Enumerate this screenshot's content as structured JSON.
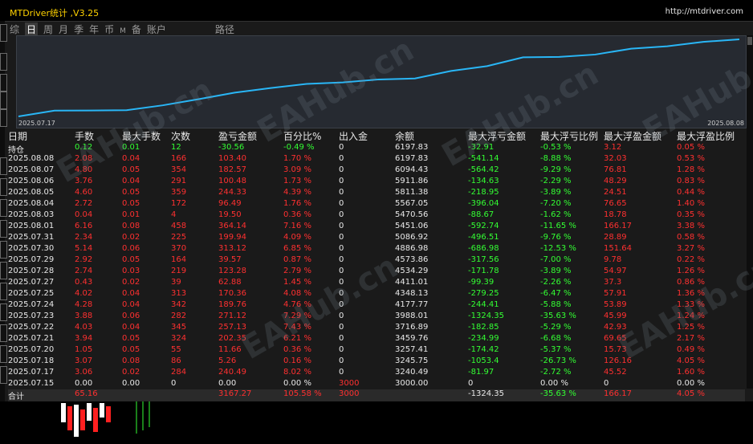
{
  "window": {
    "title": "MTDriver统计 ,V3.25",
    "url": "http://mtdriver.com"
  },
  "tabs": [
    {
      "label": "综",
      "active": false,
      "small": false
    },
    {
      "label": "日",
      "active": true,
      "small": false
    },
    {
      "label": "周",
      "active": false,
      "small": false
    },
    {
      "label": "月",
      "active": false,
      "small": false
    },
    {
      "label": "季",
      "active": false,
      "small": false
    },
    {
      "label": "年",
      "active": false,
      "small": false
    },
    {
      "label": "币",
      "active": false,
      "small": false
    },
    {
      "label": "M",
      "active": false,
      "small": true
    },
    {
      "label": "备",
      "active": false,
      "small": false
    },
    {
      "label": "账户",
      "active": false,
      "small": false
    },
    {
      "label": "路径",
      "active": false,
      "small": false,
      "path": true
    }
  ],
  "equity_chart": {
    "start_date": "2025.07.17",
    "end_date": "2025.08.08",
    "line_color": "#29b6f6",
    "values": [
      3000,
      3240.49,
      3245.75,
      3257.41,
      3459.76,
      3716.89,
      3988.01,
      4177.77,
      4348.13,
      4411.01,
      4534.29,
      4573.86,
      4886.98,
      5086.92,
      5451.06,
      5470.56,
      5567.05,
      5811.38,
      5911.86,
      6094.43,
      6197.83
    ]
  },
  "columns": [
    "日期",
    "手数",
    "最大手数",
    "次数",
    "盈亏金额",
    "百分比%",
    "出入金",
    "余额",
    "最大浮亏金额",
    "最大浮亏比例",
    "最大浮盈金额",
    "最大浮盈比例"
  ],
  "holding": {
    "label": "持仓",
    "lots": "0.12",
    "max_lots": "0.01",
    "count": "12",
    "pnl": "-30.56",
    "pct": "-0.49 %",
    "io": "0",
    "balance": "6197.83",
    "max_dd": "-32.91",
    "max_dd_pct": "-0.53 %",
    "max_fp": "3.12",
    "max_fp_pct": "0.05 %"
  },
  "rows": [
    {
      "date": "2025.08.08",
      "lots": "2.08",
      "max_lots": "0.04",
      "count": "166",
      "pnl": "103.40",
      "pct": "1.70 %",
      "io": "0",
      "balance": "6197.83",
      "max_dd": "-541.14",
      "max_dd_pct": "-8.88 %",
      "max_fp": "32.03",
      "max_fp_pct": "0.53 %"
    },
    {
      "date": "2025.08.07",
      "lots": "4.80",
      "max_lots": "0.05",
      "count": "354",
      "pnl": "182.57",
      "pct": "3.09 %",
      "io": "0",
      "balance": "6094.43",
      "max_dd": "-564.42",
      "max_dd_pct": "-9.29 %",
      "max_fp": "76.81",
      "max_fp_pct": "1.28 %"
    },
    {
      "date": "2025.08.06",
      "lots": "3.76",
      "max_lots": "0.04",
      "count": "291",
      "pnl": "100.48",
      "pct": "1.73 %",
      "io": "0",
      "balance": "5911.86",
      "max_dd": "-134.63",
      "max_dd_pct": "-2.29 %",
      "max_fp": "48.29",
      "max_fp_pct": "0.83 %"
    },
    {
      "date": "2025.08.05",
      "lots": "4.60",
      "max_lots": "0.05",
      "count": "359",
      "pnl": "244.33",
      "pct": "4.39 %",
      "io": "0",
      "balance": "5811.38",
      "max_dd": "-218.95",
      "max_dd_pct": "-3.89 %",
      "max_fp": "24.51",
      "max_fp_pct": "0.44 %"
    },
    {
      "date": "2025.08.04",
      "lots": "2.72",
      "max_lots": "0.05",
      "count": "172",
      "pnl": "96.49",
      "pct": "1.76 %",
      "io": "0",
      "balance": "5567.05",
      "max_dd": "-396.04",
      "max_dd_pct": "-7.20 %",
      "max_fp": "76.65",
      "max_fp_pct": "1.40 %"
    },
    {
      "date": "2025.08.03",
      "lots": "0.04",
      "max_lots": "0.01",
      "count": "4",
      "pnl": "19.50",
      "pct": "0.36 %",
      "io": "0",
      "balance": "5470.56",
      "max_dd": "-88.67",
      "max_dd_pct": "-1.62 %",
      "max_fp": "18.78",
      "max_fp_pct": "0.35 %"
    },
    {
      "date": "2025.08.01",
      "lots": "6.16",
      "max_lots": "0.08",
      "count": "458",
      "pnl": "364.14",
      "pct": "7.16 %",
      "io": "0",
      "balance": "5451.06",
      "max_dd": "-592.74",
      "max_dd_pct": "-11.65 %",
      "max_fp": "166.17",
      "max_fp_pct": "3.38 %"
    },
    {
      "date": "2025.07.31",
      "lots": "2.34",
      "max_lots": "0.02",
      "count": "225",
      "pnl": "199.94",
      "pct": "4.09 %",
      "io": "0",
      "balance": "5086.92",
      "max_dd": "-496.51",
      "max_dd_pct": "-9.76 %",
      "max_fp": "28.89",
      "max_fp_pct": "0.58 %"
    },
    {
      "date": "2025.07.30",
      "lots": "5.14",
      "max_lots": "0.06",
      "count": "370",
      "pnl": "313.12",
      "pct": "6.85 %",
      "io": "0",
      "balance": "4886.98",
      "max_dd": "-686.98",
      "max_dd_pct": "-12.53 %",
      "max_fp": "151.64",
      "max_fp_pct": "3.27 %"
    },
    {
      "date": "2025.07.29",
      "lots": "2.92",
      "max_lots": "0.05",
      "count": "164",
      "pnl": "39.57",
      "pct": "0.87 %",
      "io": "0",
      "balance": "4573.86",
      "max_dd": "-317.56",
      "max_dd_pct": "-7.00 %",
      "max_fp": "9.78",
      "max_fp_pct": "0.22 %"
    },
    {
      "date": "2025.07.28",
      "lots": "2.74",
      "max_lots": "0.03",
      "count": "219",
      "pnl": "123.28",
      "pct": "2.79 %",
      "io": "0",
      "balance": "4534.29",
      "max_dd": "-171.78",
      "max_dd_pct": "-3.89 %",
      "max_fp": "54.97",
      "max_fp_pct": "1.26 %"
    },
    {
      "date": "2025.07.27",
      "lots": "0.43",
      "max_lots": "0.02",
      "count": "39",
      "pnl": "62.88",
      "pct": "1.45 %",
      "io": "0",
      "balance": "4411.01",
      "max_dd": "-99.39",
      "max_dd_pct": "-2.26 %",
      "max_fp": "37.3",
      "max_fp_pct": "0.86 %"
    },
    {
      "date": "2025.07.25",
      "lots": "4.02",
      "max_lots": "0.04",
      "count": "313",
      "pnl": "170.36",
      "pct": "4.08 %",
      "io": "0",
      "balance": "4348.13",
      "max_dd": "-279.25",
      "max_dd_pct": "-6.47 %",
      "max_fp": "57.91",
      "max_fp_pct": "1.36 %"
    },
    {
      "date": "2025.07.24",
      "lots": "4.28",
      "max_lots": "0.04",
      "count": "342",
      "pnl": "189.76",
      "pct": "4.76 %",
      "io": "0",
      "balance": "4177.77",
      "max_dd": "-244.41",
      "max_dd_pct": "-5.88 %",
      "max_fp": "53.89",
      "max_fp_pct": "1.33 %"
    },
    {
      "date": "2025.07.23",
      "lots": "3.88",
      "max_lots": "0.06",
      "count": "282",
      "pnl": "271.12",
      "pct": "7.29 %",
      "io": "0",
      "balance": "3988.01",
      "max_dd": "-1324.35",
      "max_dd_pct": "-35.63 %",
      "max_fp": "45.99",
      "max_fp_pct": "1.24 %"
    },
    {
      "date": "2025.07.22",
      "lots": "4.03",
      "max_lots": "0.04",
      "count": "345",
      "pnl": "257.13",
      "pct": "7.43 %",
      "io": "0",
      "balance": "3716.89",
      "max_dd": "-182.85",
      "max_dd_pct": "-5.29 %",
      "max_fp": "42.93",
      "max_fp_pct": "1.25 %"
    },
    {
      "date": "2025.07.21",
      "lots": "3.94",
      "max_lots": "0.05",
      "count": "324",
      "pnl": "202.35",
      "pct": "6.21 %",
      "io": "0",
      "balance": "3459.76",
      "max_dd": "-234.99",
      "max_dd_pct": "-6.68 %",
      "max_fp": "69.65",
      "max_fp_pct": "2.17 %"
    },
    {
      "date": "2025.07.20",
      "lots": "1.05",
      "max_lots": "0.05",
      "count": "55",
      "pnl": "11.66",
      "pct": "0.36 %",
      "io": "0",
      "balance": "3257.41",
      "max_dd": "-174.42",
      "max_dd_pct": "-5.37 %",
      "max_fp": "15.73",
      "max_fp_pct": "0.49 %"
    },
    {
      "date": "2025.07.18",
      "lots": "3.07",
      "max_lots": "0.08",
      "count": "86",
      "pnl": "5.26",
      "pct": "0.16 %",
      "io": "0",
      "balance": "3245.75",
      "max_dd": "-1053.4",
      "max_dd_pct": "-26.73 %",
      "max_fp": "126.16",
      "max_fp_pct": "4.05 %"
    },
    {
      "date": "2025.07.17",
      "lots": "3.06",
      "max_lots": "0.02",
      "count": "284",
      "pnl": "240.49",
      "pct": "8.02 %",
      "io": "0",
      "balance": "3240.49",
      "max_dd": "-81.97",
      "max_dd_pct": "-2.72 %",
      "max_fp": "45.52",
      "max_fp_pct": "1.60 %"
    },
    {
      "date": "2025.07.15",
      "lots": "0.00",
      "max_lots": "0.00",
      "count": "0",
      "pnl": "0.00",
      "pct": "0.00 %",
      "io": "3000",
      "balance": "3000.00",
      "max_dd": "0",
      "max_dd_pct": "0.00 %",
      "max_fp": "0",
      "max_fp_pct": "0.00 %",
      "white": true
    }
  ],
  "totals": {
    "label": "合计",
    "lots": "65.16",
    "pnl": "3167.27",
    "pct": "105.58 %",
    "io": "3000",
    "max_dd": "-1324.35",
    "max_dd_pct": "-35.63 %",
    "max_fp": "166.17",
    "max_fp_pct": "4.05 %"
  },
  "watermark": "EAHub.cn",
  "colors": {
    "profit": "#ff3030",
    "loss": "#33ff33",
    "title": "#ffd200"
  }
}
